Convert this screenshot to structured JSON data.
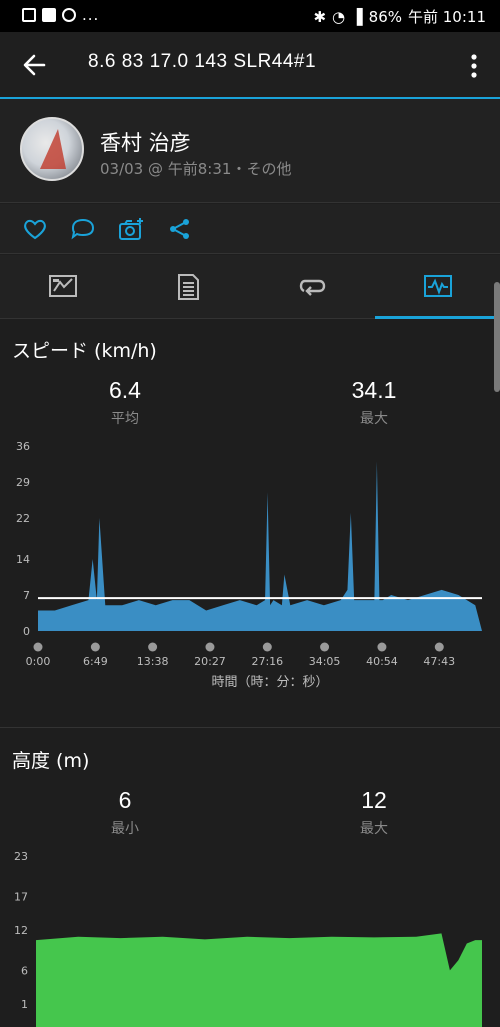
{
  "statusbar": {
    "battery": "86%",
    "time": "午前 10:11",
    "more": "..."
  },
  "appbar": {
    "title": "8.6  83  17.0  143  SLR44#1"
  },
  "profile": {
    "name": "香村 治彦",
    "meta": "03/03 @ 午前8:31・その他"
  },
  "colors": {
    "accent": "#1aa3d9",
    "speed_fill": "#3a8ec4",
    "elev_fill": "#45c64d"
  },
  "speed": {
    "title": "スピード (km/h)",
    "avg_value": "6.4",
    "avg_label": "平均",
    "max_value": "34.1",
    "max_label": "最大",
    "y_ticks": [
      "36",
      "29",
      "22",
      "14",
      "7",
      "0"
    ],
    "x_ticks": [
      "0:00",
      "6:49",
      "13:38",
      "20:27",
      "27:16",
      "34:05",
      "40:54",
      "47:43"
    ],
    "x_axis_label": "時間（時：分：秒）"
  },
  "elevation": {
    "title": "高度 (m)",
    "min_value": "6",
    "min_label": "最小",
    "max_value": "12",
    "max_label": "最大",
    "y_ticks": [
      "23",
      "17",
      "12",
      "6",
      "1"
    ]
  },
  "chart_data": [
    {
      "type": "area",
      "title": "スピード (km/h)",
      "xlabel": "時間（時：分：秒）",
      "ylabel": "",
      "ylim": [
        0,
        36
      ],
      "x_ticks": [
        "0:00",
        "6:49",
        "13:38",
        "20:27",
        "27:16",
        "34:05",
        "40:54",
        "47:43"
      ],
      "average_line": 6.4,
      "x_minutes": [
        0,
        2,
        4,
        6,
        6.5,
        7,
        7.3,
        8,
        10,
        12,
        14,
        16,
        18,
        20,
        22,
        24,
        26,
        27,
        27.3,
        27.6,
        28,
        29,
        29.3,
        30,
        32,
        34,
        36,
        36.8,
        37.2,
        37.6,
        38,
        40,
        40.3,
        40.6,
        41,
        42,
        44,
        46,
        48,
        50,
        51,
        52,
        52.8
      ],
      "values": [
        4,
        4,
        5,
        6,
        14,
        6,
        22,
        5,
        5,
        6,
        5,
        6,
        6,
        4,
        5,
        6,
        5,
        6,
        27,
        5,
        6,
        5,
        11,
        5,
        6,
        5,
        6,
        8,
        23,
        6,
        6,
        6,
        33,
        6,
        6,
        7,
        6,
        7,
        8,
        7,
        6,
        5,
        0
      ]
    },
    {
      "type": "area",
      "title": "高度 (m)",
      "xlabel": "",
      "ylabel": "",
      "ylim": [
        1,
        23
      ],
      "x_minutes": [
        0,
        5,
        10,
        15,
        20,
        25,
        30,
        35,
        40,
        45,
        48,
        49,
        50,
        51,
        52,
        52.8
      ],
      "values": [
        10.5,
        11,
        10.8,
        11,
        10.6,
        11,
        10.8,
        11,
        10.9,
        11,
        11.5,
        6,
        7.5,
        10,
        10.5,
        10.5
      ]
    }
  ]
}
